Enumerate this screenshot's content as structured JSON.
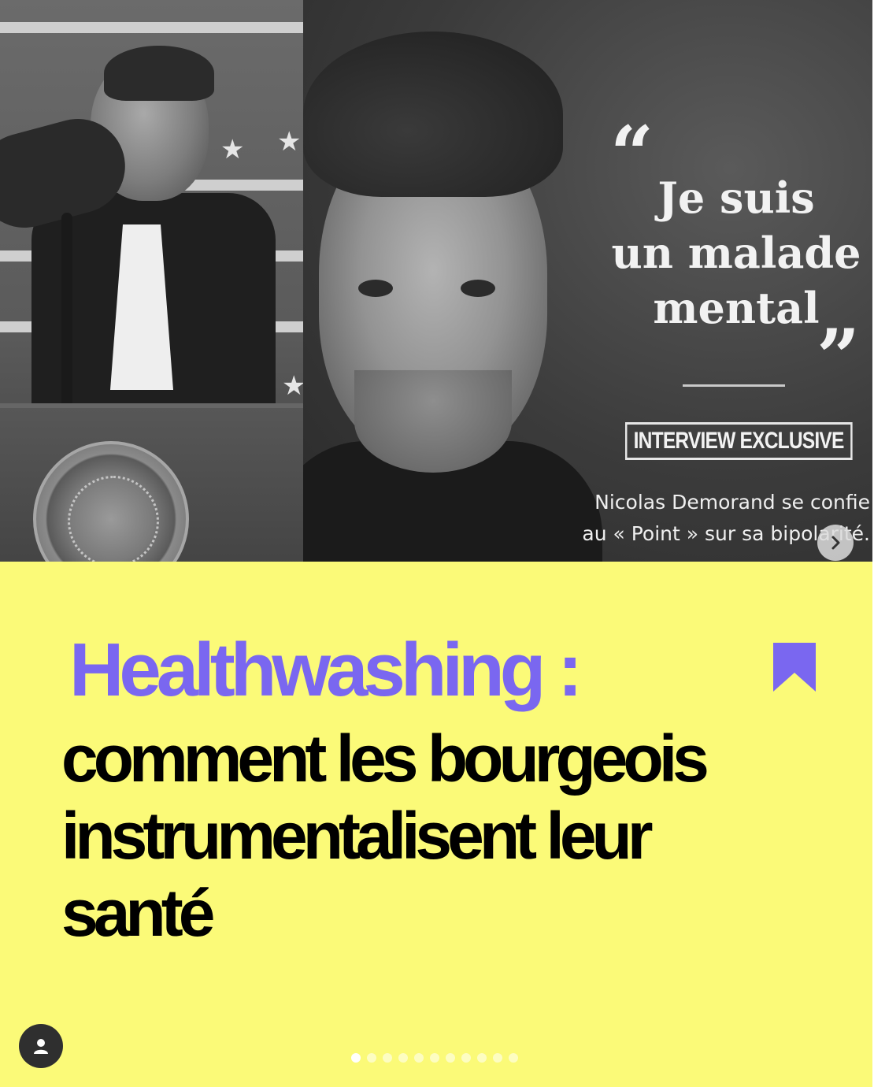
{
  "media": {
    "quote_open": "“",
    "quote_lines": [
      "Je suis",
      "un malade",
      "mental"
    ],
    "quote_close": "”",
    "badge": "INTERVIEW EXCLUSIVE",
    "caption_lines": [
      "Nicolas Demorand se confie",
      "au « Point » sur sa bipolarité."
    ],
    "next_icon": "chevron-right-icon",
    "seal_icon": "presidential-seal"
  },
  "headline": {
    "kicker": "Healthwashing :",
    "lines": [
      "comment les bourgeois",
      "instrumentalisent leur",
      "santé"
    ]
  },
  "icons": {
    "bookmark": "bookmark-icon",
    "avatar": "user-icon"
  },
  "carousel": {
    "total": 11,
    "current": 1
  },
  "colors": {
    "background": "#fbfa78",
    "kicker": "#7a67f0",
    "headline": "#000000"
  }
}
